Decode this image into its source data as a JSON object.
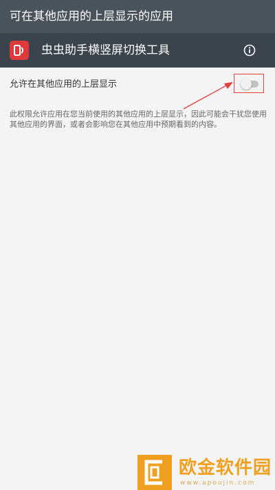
{
  "page": {
    "title": "可在其他应用的上层显示的应用"
  },
  "app": {
    "name": "虫虫助手横竖屏切换工具",
    "icon": "app-phone-rotate-icon",
    "info_icon": "info-icon"
  },
  "setting": {
    "label": "允许在其他应用的上层显示",
    "enabled": false
  },
  "description": "此权限允许应用在您当前使用的其他应用的上层显示，因此可能会干扰您使用其他应用的界面，或者会影响您在其他应用中预期看到的内容。",
  "watermark": {
    "title": "欧金软件园",
    "url": "www.apoujin.com"
  },
  "colors": {
    "topbar": "#4a525b",
    "app_row": "#3b434c",
    "app_icon": "#e0393b",
    "highlight": "#e43e3e",
    "watermark": "#f0a020"
  }
}
